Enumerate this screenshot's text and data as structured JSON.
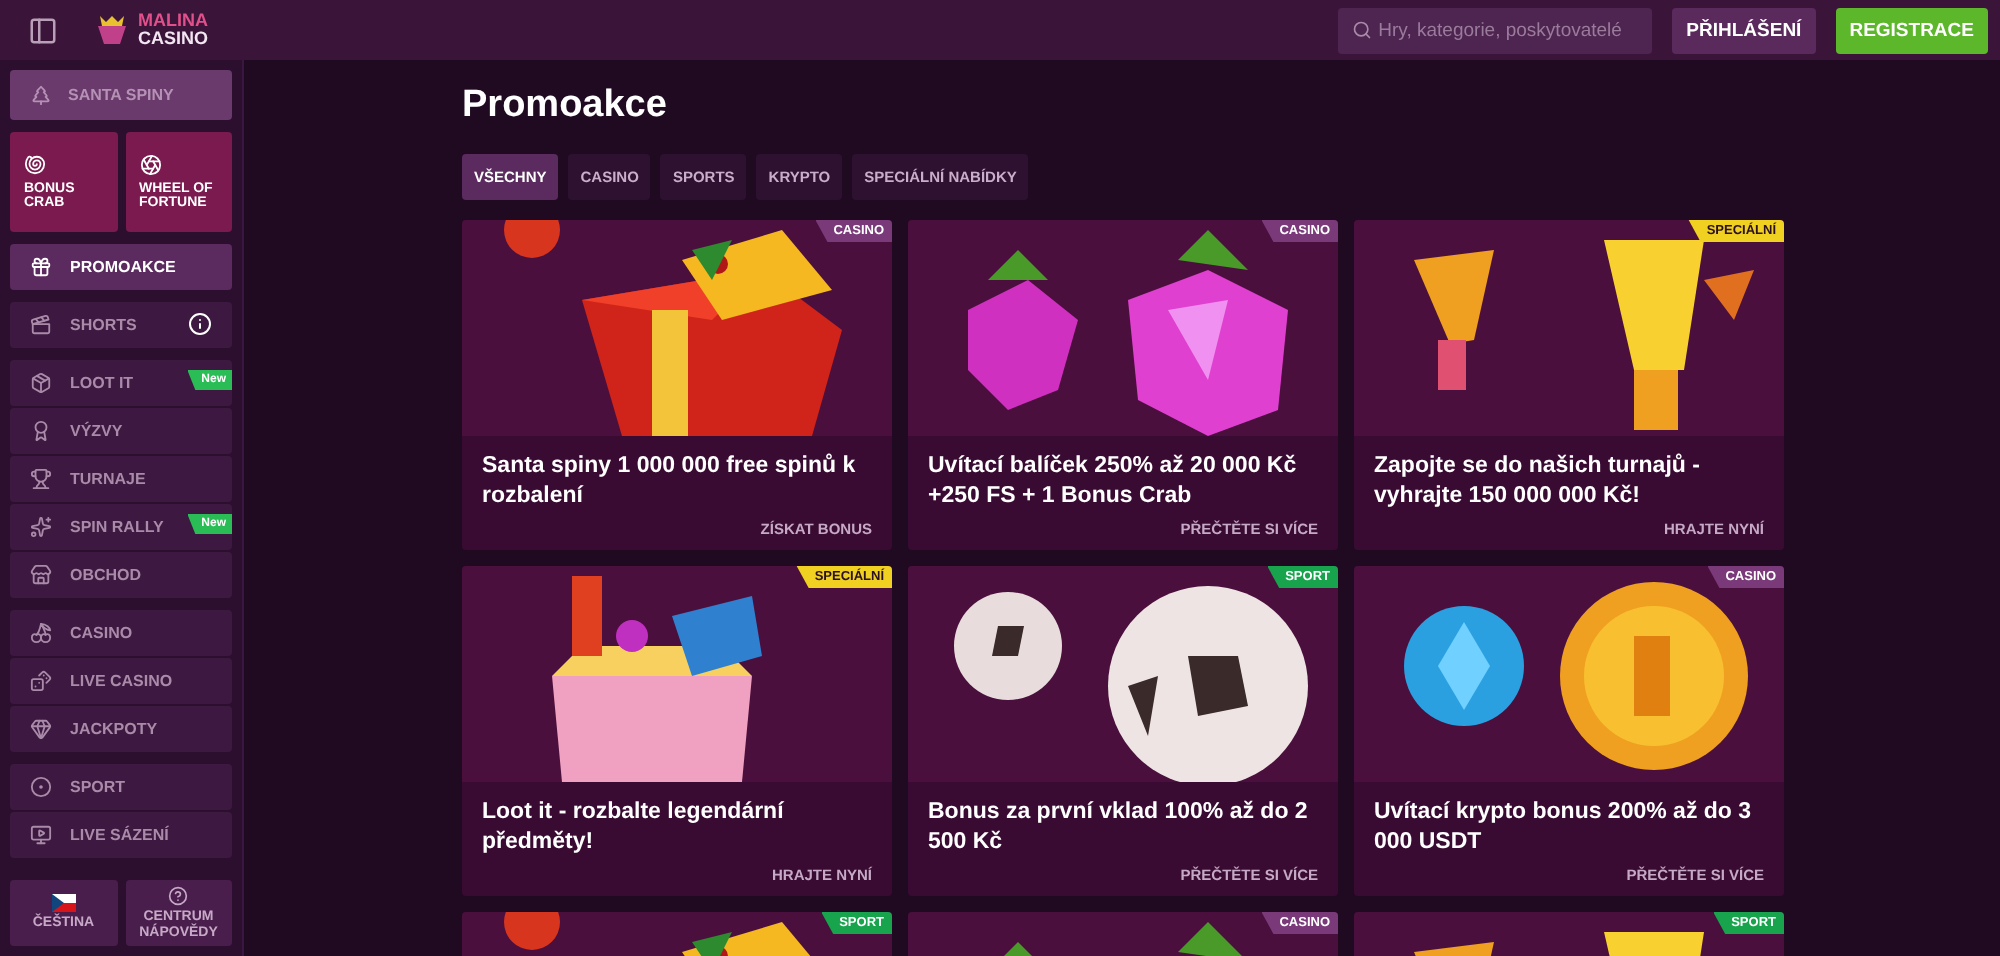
{
  "header": {
    "logo_top": "MALINA",
    "logo_bottom": "CASINO",
    "search": {
      "placeholder": "Hry, kategorie, poskytovatelé"
    },
    "buttons": [
      {
        "label": "PŘIHLÁŠENÍ",
        "kind": "secondary"
      },
      {
        "label": "REGISTRACE",
        "kind": "primary"
      }
    ]
  },
  "sidebar": {
    "banner": {
      "label": "SANTA SPINY"
    },
    "tiles": [
      {
        "label": "BONUS CRAB"
      },
      {
        "label": "WHEEL OF FORTUNE"
      }
    ],
    "groups": [
      [
        {
          "label": "PROMOAKCE",
          "selected": true
        }
      ],
      [
        {
          "label": "SHORTS",
          "selected": false,
          "info": true
        }
      ],
      [
        {
          "label": "LOOT IT",
          "selected": false,
          "badge": "New"
        },
        {
          "label": "VÝZVY",
          "selected": false
        },
        {
          "label": "TURNAJE",
          "selected": false
        },
        {
          "label": "SPIN RALLY",
          "selected": false,
          "badge": "New"
        },
        {
          "label": "OBCHOD",
          "selected": false
        }
      ],
      [
        {
          "label": "CASINO",
          "selected": false
        },
        {
          "label": "LIVE CASINO",
          "selected": false
        },
        {
          "label": "JACKPOTY",
          "selected": false
        }
      ],
      [
        {
          "label": "SPORT",
          "selected": false
        },
        {
          "label": "LIVE SÁZENÍ",
          "selected": false
        }
      ]
    ],
    "footer": [
      {
        "label": "ČEŠTINA",
        "kind": "language"
      },
      {
        "label": "CENTRUM NÁPOVĚDY",
        "kind": "help"
      }
    ]
  },
  "main": {
    "title": "Promoakce",
    "tabs": [
      {
        "label": "VŠECHNY",
        "selected": true
      },
      {
        "label": "CASINO",
        "selected": false
      },
      {
        "label": "SPORTS",
        "selected": false
      },
      {
        "label": "KRYPTO",
        "selected": false
      },
      {
        "label": "SPECIÁLNÍ NABÍDKY",
        "selected": false
      }
    ],
    "cards": [
      {
        "tag": "CASINO",
        "color": "#7a3a7a",
        "title": "Santa spiny 1 000 000 free spinů k rozbalení",
        "link": "ZÍSKAT BONUS"
      },
      {
        "tag": "CASINO",
        "color": "#7a3a7a",
        "title": "Uvítací balíček 250% až 20 000 Kč +250 FS + 1 Bonus Crab",
        "link": "PŘEČTĚTE SI VÍCE"
      },
      {
        "tag": "SPECIÁLNÍ",
        "color": "#f0d020",
        "title": "Zapojte se do našich turnajů - vyhrajte 150 000 000 Kč!",
        "link": "HRAJTE NYNÍ"
      },
      {
        "tag": "SPECIÁLNÍ",
        "color": "#f0d020",
        "title": "Loot it - rozbalte legendární předměty!",
        "link": "HRAJTE NYNÍ"
      },
      {
        "tag": "SPORT",
        "color": "#17a44c",
        "title": "Bonus za první vklad 100% až do 2 500 Kč",
        "link": "PŘEČTĚTE SI VÍCE"
      },
      {
        "tag": "CASINO",
        "color": "#7a3a7a",
        "title": "Uvítací krypto bonus 200% až do 3 000 USDT",
        "link": "PŘEČTĚTE SI VÍCE"
      },
      {
        "tag": "SPORT",
        "color": "#17a44c"
      },
      {
        "tag": "CASINO",
        "color": "#7a3a7a"
      },
      {
        "tag": "SPORT",
        "color": "#17a44c"
      }
    ]
  }
}
